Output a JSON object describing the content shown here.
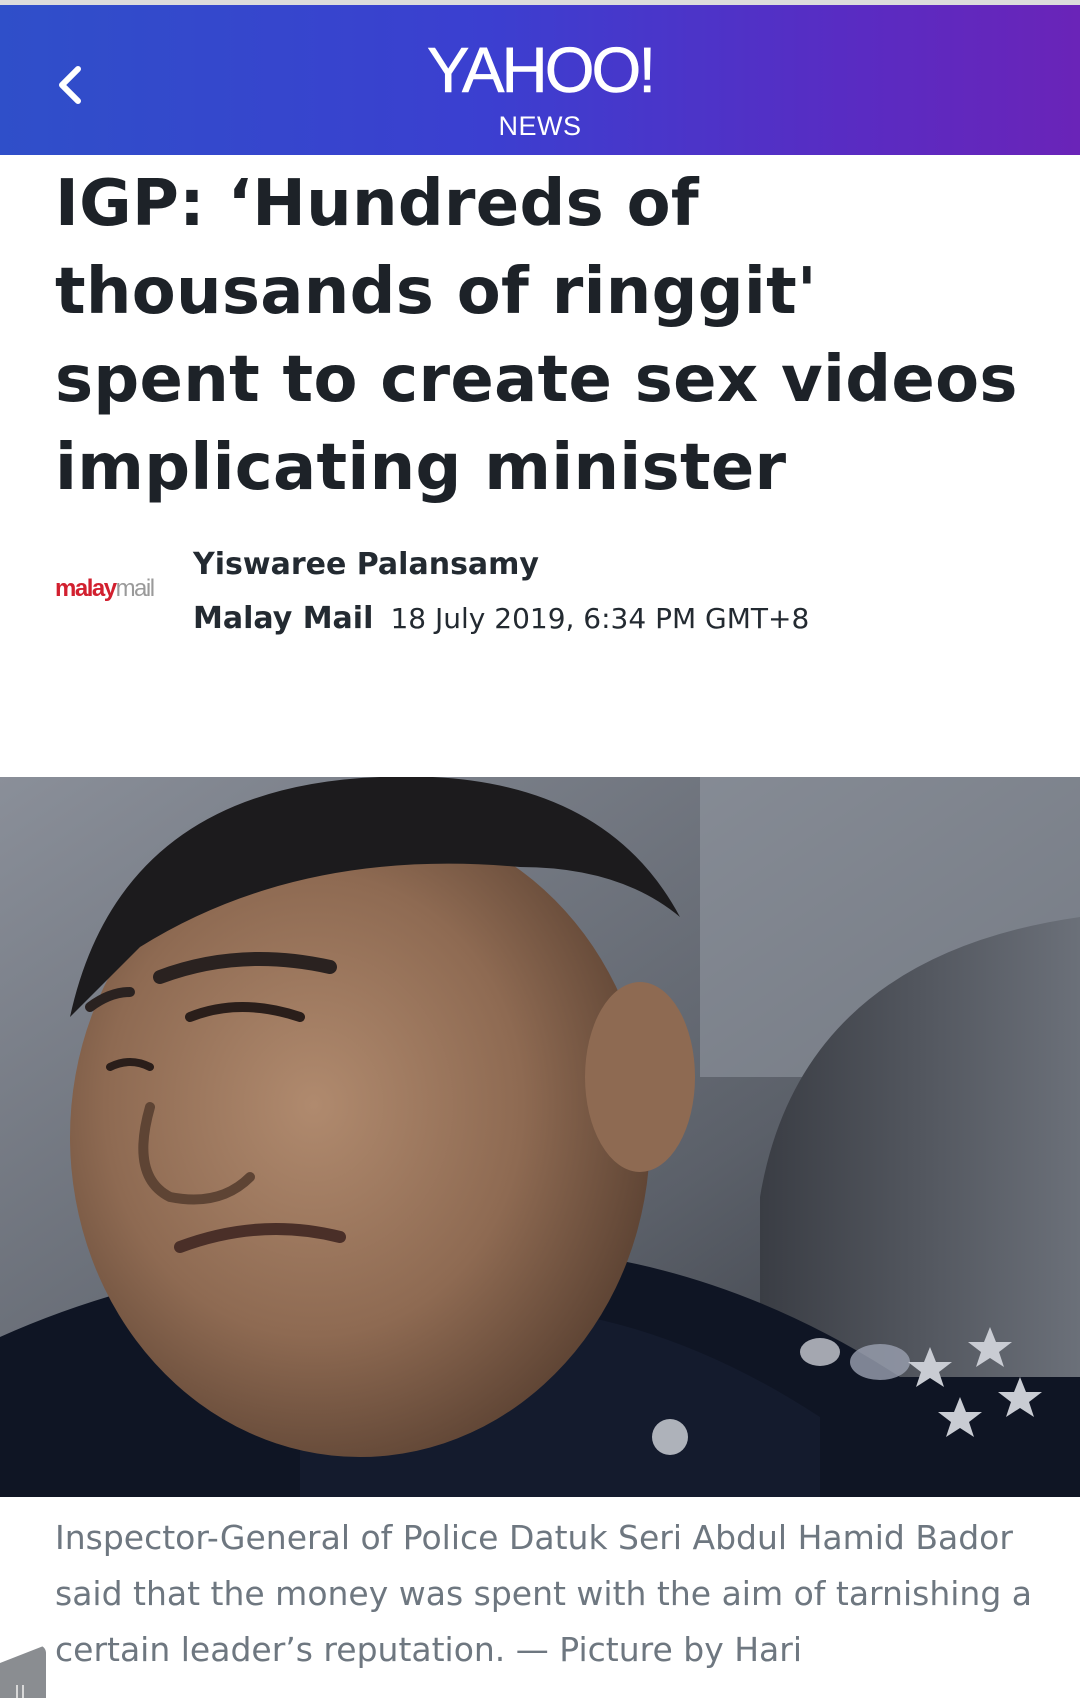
{
  "header": {
    "back_label": "Back",
    "logo_main": "YAHOO!",
    "logo_sub": "NEWS",
    "gradient_start": "#2f4fc9",
    "gradient_end": "#6a24b8"
  },
  "article": {
    "headline": "IGP: ‘Hundreds of thousands of ringgit' spent to create sex videos implicating minister",
    "provider_logo": {
      "part_a": "malay",
      "part_b": "mail"
    },
    "author": "Yiswaree Palansamy",
    "publisher": "Malay Mail",
    "timestamp": "18 July 2019, 6:34 PM GMT+8",
    "image_icon": "photo-of-police-officer",
    "caption": "Inspector-General of Police Datuk Seri Abdul Hamid Bador said that the money was spent with the aim of tarnishing a certain leader’s reputation. — Picture by Hari"
  },
  "colors": {
    "headline": "#1d2228",
    "caption": "#6e7780",
    "provider_red": "#d2202f"
  }
}
